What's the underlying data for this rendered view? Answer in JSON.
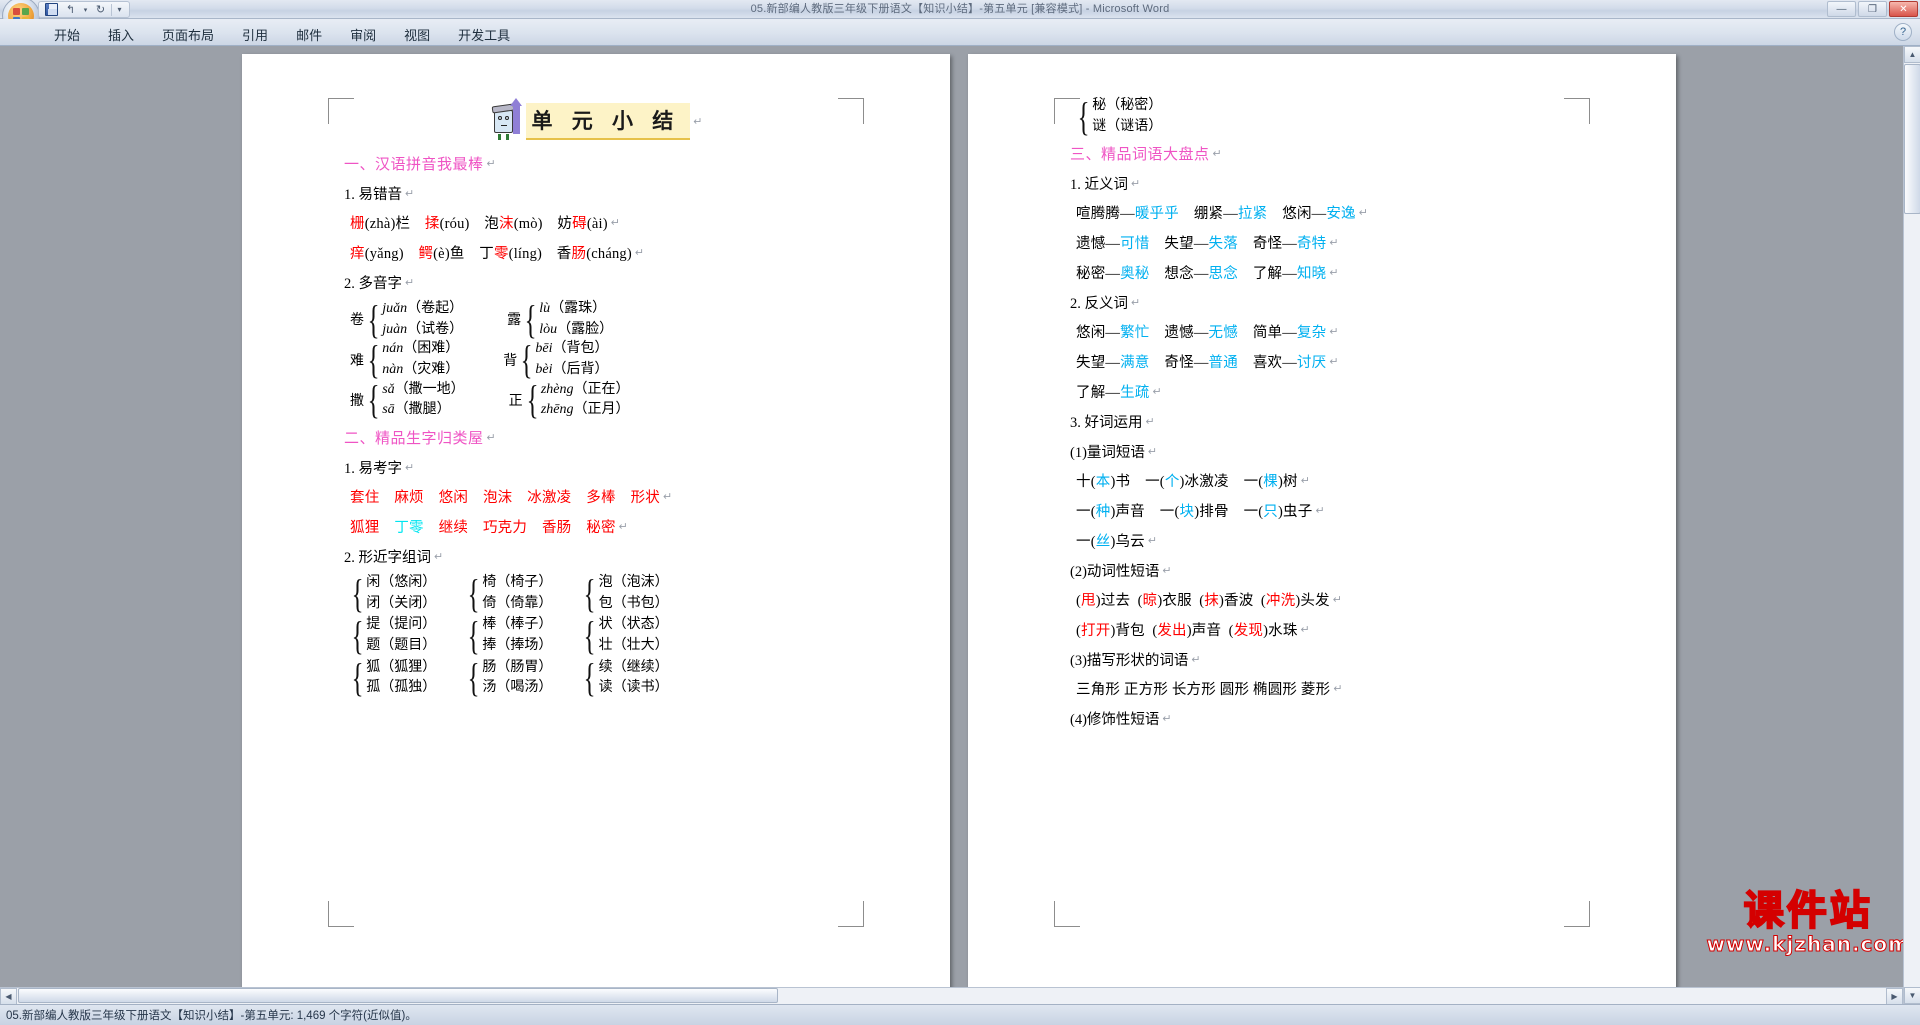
{
  "window": {
    "title": "05.新部编人教版三年级下册语文【知识小结】-第五单元 [兼容模式] - Microsoft Word",
    "minimize_label": "—",
    "restore_label": "❐",
    "close_label": "✕"
  },
  "quick_access": {
    "save_tooltip": "save-icon",
    "undo_label": "↰",
    "undo_dropdown_label": "▾",
    "redo_label": "↻",
    "customize_label": "▾"
  },
  "ribbon": {
    "tabs": [
      {
        "label": "开始",
        "active": false
      },
      {
        "label": "插入",
        "active": false
      },
      {
        "label": "页面布局",
        "active": false
      },
      {
        "label": "引用",
        "active": false
      },
      {
        "label": "邮件",
        "active": false
      },
      {
        "label": "审阅",
        "active": false
      },
      {
        "label": "视图",
        "active": false
      },
      {
        "label": "开发工具",
        "active": false
      }
    ],
    "help_label": "?"
  },
  "scrollbars": {
    "up_arrow": "▲",
    "down_arrow": "▼",
    "left_arrow": "◀",
    "right_arrow": "▶"
  },
  "statusbar": {
    "text": "05.新部编人教版三年级下册语文【知识小结】-第五单元: 1,469 个字符(近似值)。"
  },
  "watermark": {
    "main": "课件站",
    "sub": "www.kjzhan.com"
  },
  "document": {
    "title": "单 元 小 结",
    "pilcrow": "↵",
    "left_page": {
      "sections": [
        {
          "type": "heading",
          "text": "一、汉语拼音我最棒"
        },
        {
          "type": "subheading",
          "text": "1. 易错音"
        },
        {
          "type": "pinyin_line",
          "items": [
            {
              "han": "栅",
              "han_color": "red",
              "py": "(zhà)",
              "tail": "栏",
              "tail_color": "black"
            },
            {
              "han": "揉",
              "han_color": "red",
              "py": "(róu)",
              "tail": "",
              "tail_color": "black"
            },
            {
              "han": "泡",
              "han_color": "black",
              "py": "",
              "tail": "",
              "tail_color": "black",
              "han2": "沫",
              "han2_color": "red",
              "py2": "(mò)"
            },
            {
              "han": "妨",
              "han_color": "black",
              "py": "",
              "tail": "",
              "tail_color": "black",
              "han2": "碍",
              "han2_color": "red",
              "py2": "(ài)"
            }
          ]
        },
        {
          "type": "pinyin_line",
          "items": [
            {
              "han": "痒",
              "han_color": "red",
              "py": "(yǎng)",
              "tail": "",
              "tail_color": "black"
            },
            {
              "han": "鳄",
              "han_color": "red",
              "py": "(è)",
              "tail": "鱼",
              "tail_color": "black"
            },
            {
              "han": "丁",
              "han_color": "black",
              "py": "",
              "tail": "",
              "tail_color": "black",
              "han2": "零",
              "han2_color": "red",
              "py2": "(líng)"
            },
            {
              "han": "香",
              "han_color": "black",
              "py": "",
              "tail": "",
              "tail_color": "black",
              "han2": "肠",
              "han2_color": "red",
              "py2": "(cháng)"
            }
          ]
        },
        {
          "type": "subheading",
          "text": "2. 多音字"
        },
        {
          "type": "brace_rows",
          "rows": [
            [
              {
                "char": "卷",
                "items": [
                  "juǎn（卷起）",
                  "juàn（试卷）"
                ]
              },
              {
                "char": "露",
                "items": [
                  "lù（露珠）",
                  "lòu（露脸）"
                ]
              }
            ],
            [
              {
                "char": "难",
                "items": [
                  "nán（困难）",
                  "nàn（灾难）"
                ]
              },
              {
                "char": "背",
                "items": [
                  "bēi（背包）",
                  "bèi（后背）"
                ]
              }
            ],
            [
              {
                "char": "撒",
                "items": [
                  "sǎ（撒一地）",
                  "sā（撒腿）"
                ]
              },
              {
                "char": "正",
                "items": [
                  "zhèng（正在）",
                  "zhēng（正月）"
                ]
              }
            ]
          ]
        },
        {
          "type": "heading",
          "text": "二、精品生字归类屋"
        },
        {
          "type": "subheading",
          "text": "1. 易考字"
        },
        {
          "type": "word_line",
          "words": [
            {
              "t": "套住",
              "c": "red"
            },
            {
              "t": "麻烦",
              "c": "red"
            },
            {
              "t": "悠闲",
              "c": "red"
            },
            {
              "t": "泡沫",
              "c": "red"
            },
            {
              "t": "冰激凌",
              "c": "red"
            },
            {
              "t": "多棒",
              "c": "red"
            },
            {
              "t": "形状",
              "c": "red"
            }
          ]
        },
        {
          "type": "word_line",
          "words": [
            {
              "t": "狐狸",
              "c": "red"
            },
            {
              "t": "丁零",
              "c": "cyan"
            },
            {
              "t": "继续",
              "c": "red"
            },
            {
              "t": "巧克力",
              "c": "red"
            },
            {
              "t": "香肠",
              "c": "red"
            },
            {
              "t": "秘密",
              "c": "red"
            }
          ]
        },
        {
          "type": "subheading",
          "text": "2. 形近字组词"
        },
        {
          "type": "nj_rows",
          "rows": [
            [
              {
                "items": [
                  "闲（悠闲）",
                  "闭（关闭）"
                ]
              },
              {
                "items": [
                  "椅（椅子）",
                  "倚（倚靠）"
                ]
              },
              {
                "items": [
                  "泡（泡沫）",
                  "包（书包）"
                ]
              }
            ],
            [
              {
                "items": [
                  "提（提问）",
                  "题（题目）"
                ]
              },
              {
                "items": [
                  "棒（棒子）",
                  "捧（捧场）"
                ]
              },
              {
                "items": [
                  "状（状态）",
                  "壮（壮大）"
                ]
              }
            ],
            [
              {
                "items": [
                  "狐（狐狸）",
                  "孤（孤独）"
                ]
              },
              {
                "items": [
                  "肠（肠胃）",
                  "汤（喝汤）"
                ]
              },
              {
                "items": [
                  "续（继续）",
                  "读（读书）"
                ]
              }
            ]
          ]
        }
      ]
    },
    "right_page": {
      "sections": [
        {
          "type": "nj_rows",
          "rows": [
            [
              {
                "items": [
                  "秘（秘密）",
                  "谜（谜语）"
                ]
              }
            ]
          ]
        },
        {
          "type": "heading",
          "text": "三、精品词语大盘点"
        },
        {
          "type": "subheading",
          "text": "1. 近义词"
        },
        {
          "type": "pair_line",
          "pairs": [
            {
              "a": "喧腾腾",
              "b": "暖乎乎"
            },
            {
              "a": "绷紧",
              "b": "拉紧"
            },
            {
              "a": "悠闲",
              "b": "安逸"
            }
          ]
        },
        {
          "type": "pair_line",
          "pairs": [
            {
              "a": "遗憾",
              "b": "可惜"
            },
            {
              "a": "失望",
              "b": "失落"
            },
            {
              "a": "奇怪",
              "b": "奇特"
            }
          ]
        },
        {
          "type": "pair_line",
          "pairs": [
            {
              "a": "秘密",
              "b": "奥秘"
            },
            {
              "a": "想念",
              "b": "思念"
            },
            {
              "a": "了解",
              "b": "知晓"
            }
          ]
        },
        {
          "type": "subheading",
          "text": "2. 反义词"
        },
        {
          "type": "pair_line",
          "pairs": [
            {
              "a": "悠闲",
              "b": "繁忙"
            },
            {
              "a": "遗憾",
              "b": "无憾"
            },
            {
              "a": "简单",
              "b": "复杂"
            }
          ]
        },
        {
          "type": "pair_line",
          "pairs": [
            {
              "a": "失望",
              "b": "满意"
            },
            {
              "a": "奇怪",
              "b": "普通"
            },
            {
              "a": "喜欢",
              "b": "讨厌"
            }
          ]
        },
        {
          "type": "pair_line",
          "pairs": [
            {
              "a": "了解",
              "b": "生疏"
            }
          ]
        },
        {
          "type": "subheading",
          "text": "3. 好词运用"
        },
        {
          "type": "subheading",
          "text": "(1)量词短语"
        },
        {
          "type": "quant_line",
          "parts": [
            {
              "pre": "十(",
              "hl": "本",
              "post": ")书"
            },
            {
              "pre": "一(",
              "hl": "个",
              "post": ")冰激凌"
            },
            {
              "pre": "一(",
              "hl": "棵",
              "post": ")树"
            }
          ]
        },
        {
          "type": "quant_line",
          "parts": [
            {
              "pre": "一(",
              "hl": "种",
              "post": ")声音"
            },
            {
              "pre": "一(",
              "hl": "块",
              "post": ")排骨"
            },
            {
              "pre": "一(",
              "hl": "只",
              "post": ")虫子"
            }
          ]
        },
        {
          "type": "quant_line",
          "parts": [
            {
              "pre": "一(",
              "hl": "丝",
              "post": ")乌云"
            }
          ]
        },
        {
          "type": "subheading",
          "text": "(2)动词性短语"
        },
        {
          "type": "verb_line",
          "parts": [
            {
              "hl": "甩",
              "post": "过去"
            },
            {
              "hl": "晾",
              "post": "衣服"
            },
            {
              "hl": "抹",
              "post": "香波"
            },
            {
              "hl": "冲洗",
              "post": "头发"
            }
          ]
        },
        {
          "type": "verb_line",
          "parts": [
            {
              "hl": "打开",
              "post": "背包"
            },
            {
              "hl": "发出",
              "post": "声音"
            },
            {
              "hl": "发现",
              "post": "水珠"
            }
          ]
        },
        {
          "type": "subheading",
          "text": "(3)描写形状的词语"
        },
        {
          "type": "plain_line",
          "text": "三角形  正方形  长方形  圆形  椭圆形  菱形"
        },
        {
          "type": "subheading",
          "text": "(4)修饰性短语"
        }
      ]
    }
  }
}
